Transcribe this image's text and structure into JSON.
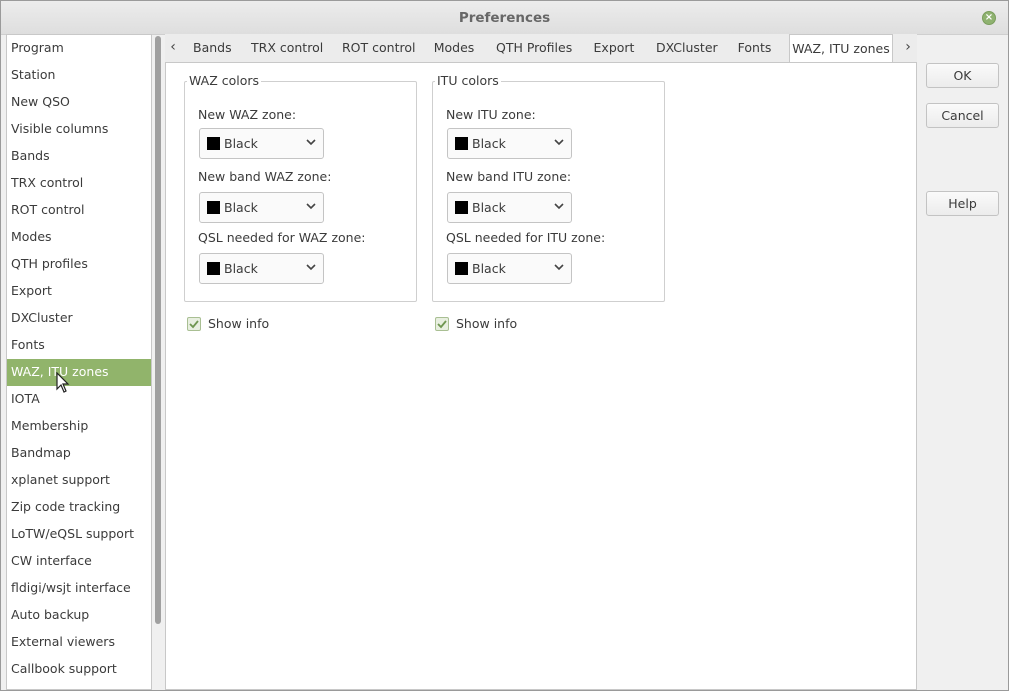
{
  "window": {
    "title": "Preferences"
  },
  "sidebar": {
    "items": [
      {
        "label": "Program"
      },
      {
        "label": "Station"
      },
      {
        "label": "New QSO"
      },
      {
        "label": "Visible columns"
      },
      {
        "label": "Bands"
      },
      {
        "label": "TRX control"
      },
      {
        "label": "ROT control"
      },
      {
        "label": "Modes"
      },
      {
        "label": "QTH profiles"
      },
      {
        "label": "Export"
      },
      {
        "label": "DXCluster"
      },
      {
        "label": "Fonts"
      },
      {
        "label": "WAZ, ITU zones",
        "active": true
      },
      {
        "label": "IOTA"
      },
      {
        "label": "Membership"
      },
      {
        "label": "Bandmap"
      },
      {
        "label": "xplanet support"
      },
      {
        "label": "Zip code tracking"
      },
      {
        "label": "LoTW/eQSL support"
      },
      {
        "label": "CW interface"
      },
      {
        "label": "fldigi/wsjt interface"
      },
      {
        "label": "Auto backup"
      },
      {
        "label": "External viewers"
      },
      {
        "label": "Callbook support"
      }
    ]
  },
  "tabs": [
    {
      "label": "Bands"
    },
    {
      "label": "TRX control"
    },
    {
      "label": "ROT control"
    },
    {
      "label": "Modes"
    },
    {
      "label": "QTH Profiles"
    },
    {
      "label": "Export"
    },
    {
      "label": "DXCluster"
    },
    {
      "label": "Fonts"
    },
    {
      "label": "WAZ, ITU zones",
      "active": true
    }
  ],
  "waz": {
    "title": "WAZ colors",
    "new_zone_label": "New WAZ zone:",
    "new_zone_value": "Black",
    "new_band_label": "New band WAZ zone:",
    "new_band_value": "Black",
    "qsl_label": "QSL needed for WAZ zone:",
    "qsl_value": "Black",
    "show_info_label": "Show info",
    "show_info_checked": true
  },
  "itu": {
    "title": "ITU colors",
    "new_zone_label": "New ITU zone:",
    "new_zone_value": "Black",
    "new_band_label": "New band ITU zone:",
    "new_band_value": "Black",
    "qsl_label": "QSL needed for ITU zone:",
    "qsl_value": "Black",
    "show_info_label": "Show info",
    "show_info_checked": true
  },
  "buttons": {
    "ok": "OK",
    "cancel": "Cancel",
    "help": "Help"
  },
  "colors": {
    "accent": "#91b46b",
    "swatch": "#000000"
  }
}
